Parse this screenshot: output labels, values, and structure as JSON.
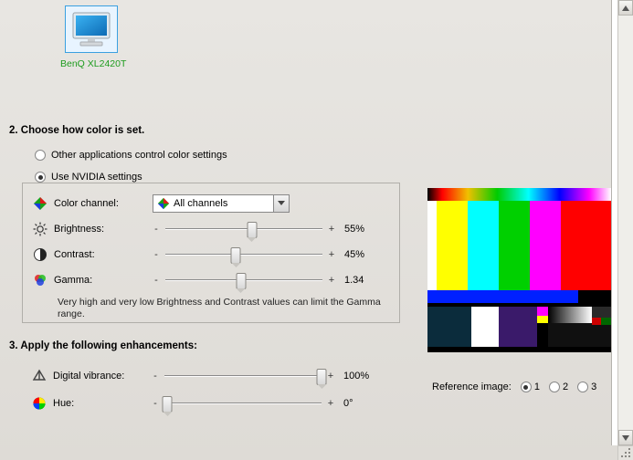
{
  "monitor": {
    "name": "BenQ XL2420T"
  },
  "section2": {
    "heading": "2. Choose how color is set."
  },
  "radios": {
    "other": {
      "label": "Other applications control color settings",
      "selected": false
    },
    "nvidia": {
      "label": "Use NVIDIA settings",
      "selected": true
    }
  },
  "colorChannel": {
    "label": "Color channel:",
    "selected": "All channels"
  },
  "sliders": {
    "brightness": {
      "label": "Brightness:",
      "value": "55%",
      "percent": 55
    },
    "contrast": {
      "label": "Contrast:",
      "value": "45%",
      "percent": 45
    },
    "gamma": {
      "label": "Gamma:",
      "value": "1.34",
      "percent": 48
    },
    "vibrance": {
      "label": "Digital vibrance:",
      "value": "100%",
      "percent": 100
    },
    "hue": {
      "label": "Hue:",
      "value": "0°",
      "percent": 0
    }
  },
  "hint": "Very high and very low Brightness and Contrast values can limit the Gamma range.",
  "section3": {
    "heading": "3. Apply the following enhancements:"
  },
  "reference": {
    "label": "Reference image:",
    "opts": [
      "1",
      "2",
      "3"
    ],
    "selected": 0
  }
}
